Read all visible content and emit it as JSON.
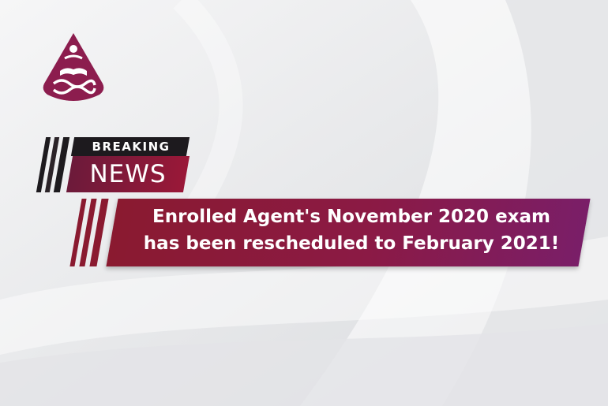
{
  "badge": {
    "breaking_label": "BREAKING",
    "news_label": "NEWS"
  },
  "headline": {
    "line1": "Enrolled Agent's November 2020 exam",
    "line2": "has been rescheduled to February 2021!"
  },
  "logo": {
    "icon": "reading-person-logo",
    "color": "#8c1d4e"
  },
  "colors": {
    "banner_start": "#8a1a30",
    "banner_end": "#7a1e68",
    "dark_label": "#1d1a1e",
    "background": "#e9eaec"
  }
}
